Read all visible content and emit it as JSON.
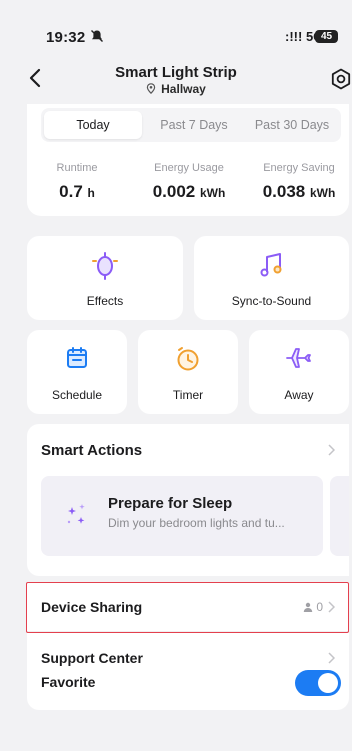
{
  "status_bar": {
    "time": "19:32",
    "network": "5G",
    "battery": "45"
  },
  "header": {
    "title": "Smart Light Strip",
    "location": "Hallway"
  },
  "period_tabs": [
    "Today",
    "Past 7 Days",
    "Past 30 Days"
  ],
  "active_tab": "Today",
  "metrics": [
    {
      "label": "Runtime",
      "value": "0.7",
      "unit": "h"
    },
    {
      "label": "Energy Usage",
      "value": "0.002",
      "unit": "kWh"
    },
    {
      "label": "Energy Saving",
      "value": "0.038",
      "unit": "kWh"
    }
  ],
  "tiles": {
    "effects": "Effects",
    "sync": "Sync-to-Sound",
    "schedule": "Schedule",
    "timer": "Timer",
    "away": "Away"
  },
  "smart_actions": {
    "title": "Smart Actions",
    "item_title": "Prepare for Sleep",
    "item_desc": "Dim your bedroom lights and tu..."
  },
  "list": {
    "device_sharing": "Device Sharing",
    "sharing_count": "0",
    "support_center": "Support Center",
    "favorite": "Favorite",
    "favorite_on": true
  },
  "colors": {
    "accent_purple": "#8b5cf6",
    "accent_orange": "#f0a030",
    "accent_blue": "#1c7cf3",
    "highlight_red": "#e4404e"
  }
}
